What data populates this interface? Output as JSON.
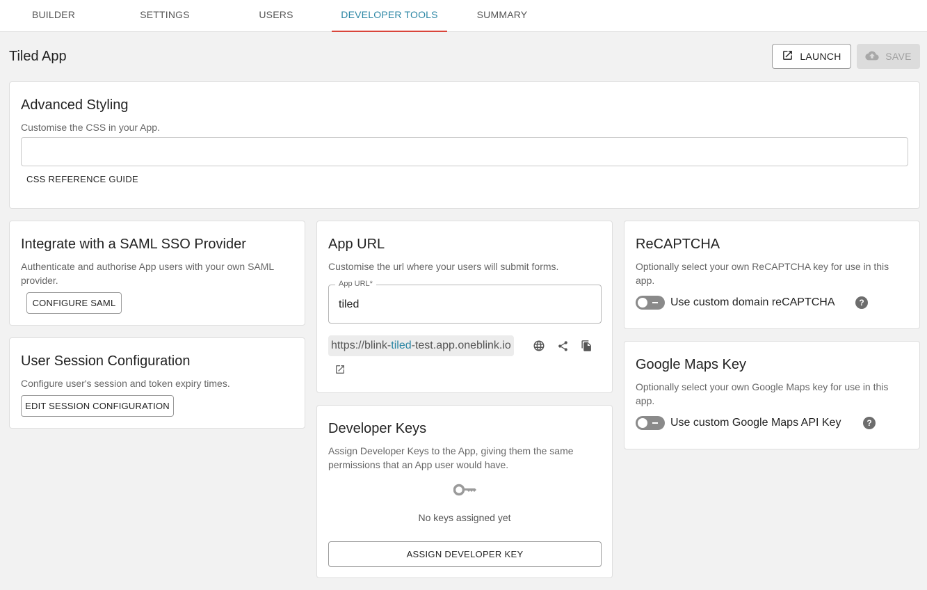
{
  "tabs": [
    "BUILDER",
    "SETTINGS",
    "USERS",
    "DEVELOPER TOOLS",
    "SUMMARY"
  ],
  "active_tab": "DEVELOPER TOOLS",
  "page": {
    "title": "Tiled App",
    "launch_label": "LAUNCH",
    "save_label": "SAVE"
  },
  "advanced_styling": {
    "title": "Advanced Styling",
    "description": "Customise the CSS in your App.",
    "css_value": "",
    "reference_label": "CSS REFERENCE GUIDE"
  },
  "saml": {
    "title": "Integrate with a SAML SSO Provider",
    "description": "Authenticate and authorise App users with your own SAML provider.",
    "button": "CONFIGURE SAML"
  },
  "session": {
    "title": "User Session Configuration",
    "description": "Configure user's session and token expiry times.",
    "button": "EDIT SESSION CONFIGURATION"
  },
  "app_url": {
    "title": "App URL",
    "description": "Customise the url where your users will submit forms.",
    "field_label": "App URL*",
    "field_value": "tiled",
    "url_prefix": "https://blink-",
    "url_highlight": "tiled",
    "url_suffix": "-test.app.oneblink.io"
  },
  "developer_keys": {
    "title": "Developer Keys",
    "description": "Assign Developer Keys to the App, giving them the same permissions that an App user would have.",
    "empty_text": "No keys assigned yet",
    "button": "ASSIGN DEVELOPER KEY"
  },
  "recaptcha": {
    "title": "ReCAPTCHA",
    "description": "Optionally select your own ReCAPTCHA key for use in this app.",
    "toggle_label": "Use custom domain reCAPTCHA",
    "enabled": false
  },
  "google_maps": {
    "title": "Google Maps Key",
    "description": "Optionally select your own Google Maps key for use in this app.",
    "toggle_label": "Use custom Google Maps API Key",
    "enabled": false
  },
  "colors": {
    "accent": "#2b86a4",
    "tab_indicator": "#d9453a",
    "background": "#f2f2f2"
  },
  "icons": {
    "launch": "open-in-new-icon",
    "save": "cloud-upload-icon",
    "globe": "globe-icon",
    "share": "share-icon",
    "copy": "copy-icon",
    "external": "open-in-new-icon",
    "key": "key-icon",
    "help": "help-icon"
  }
}
